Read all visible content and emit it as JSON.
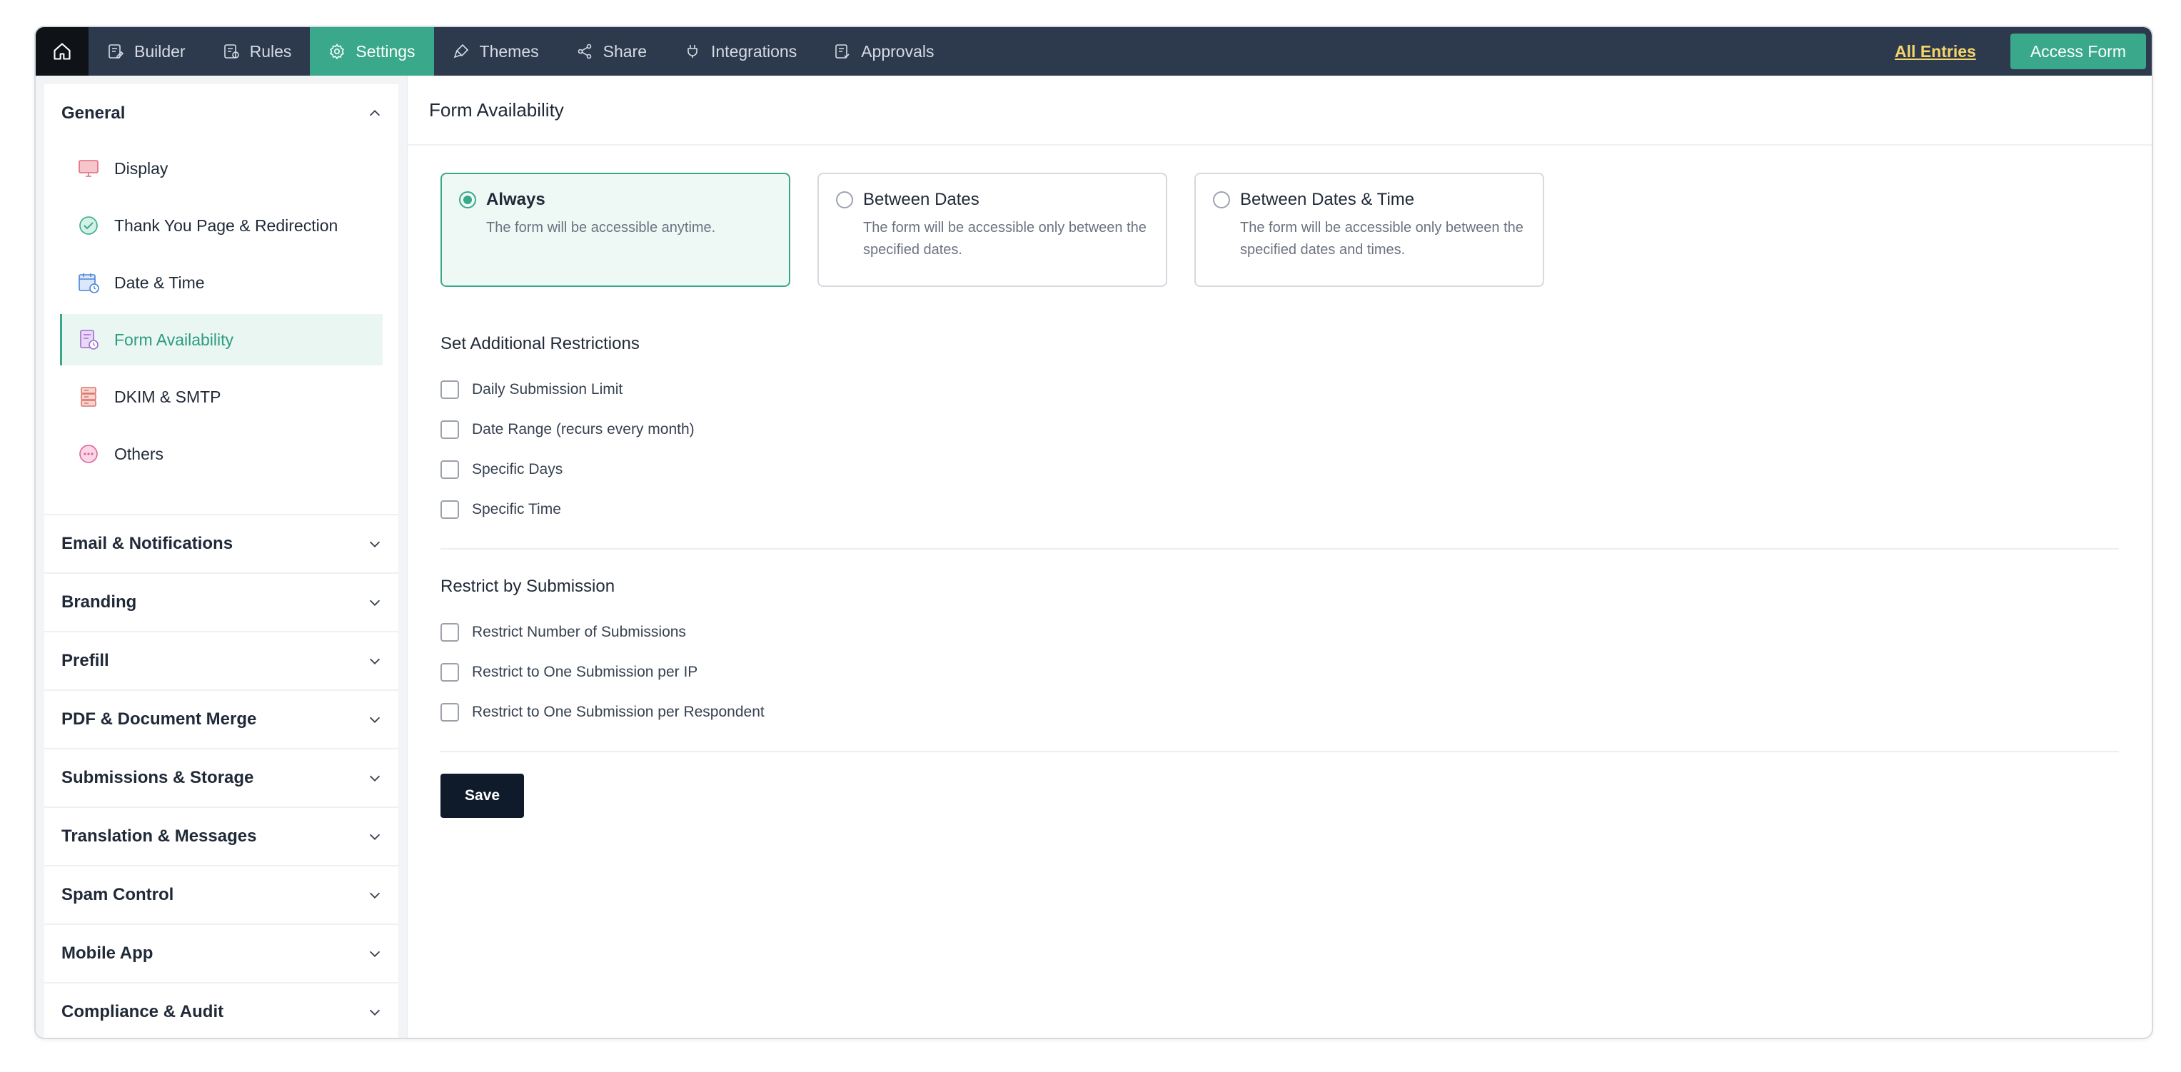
{
  "topbar": {
    "home_icon": "home-icon",
    "nav": [
      {
        "label": "Builder",
        "icon": "builder-icon",
        "active": false
      },
      {
        "label": "Rules",
        "icon": "rules-icon",
        "active": false
      },
      {
        "label": "Settings",
        "icon": "gear-icon",
        "active": true
      },
      {
        "label": "Themes",
        "icon": "brush-icon",
        "active": false
      },
      {
        "label": "Share",
        "icon": "share-icon",
        "active": false
      },
      {
        "label": "Integrations",
        "icon": "plug-icon",
        "active": false
      },
      {
        "label": "Approvals",
        "icon": "approvals-icon",
        "active": false
      }
    ],
    "all_entries_label": "All Entries",
    "access_form_label": "Access Form"
  },
  "sidebar": {
    "general": {
      "title": "General",
      "items": [
        {
          "label": "Display",
          "icon": "monitor-icon",
          "active": false
        },
        {
          "label": "Thank You Page & Redirection",
          "icon": "check-circle-icon",
          "active": false
        },
        {
          "label": "Date & Time",
          "icon": "calendar-clock-icon",
          "active": false
        },
        {
          "label": "Form Availability",
          "icon": "form-availability-icon",
          "active": true
        },
        {
          "label": "DKIM & SMTP",
          "icon": "server-icon",
          "active": false
        },
        {
          "label": "Others",
          "icon": "more-icon",
          "active": false
        }
      ]
    },
    "sections": [
      {
        "title": "Email & Notifications"
      },
      {
        "title": "Branding"
      },
      {
        "title": "Prefill"
      },
      {
        "title": "PDF & Document Merge"
      },
      {
        "title": "Submissions & Storage"
      },
      {
        "title": "Translation & Messages"
      },
      {
        "title": "Spam Control"
      },
      {
        "title": "Mobile App"
      },
      {
        "title": "Compliance & Audit"
      }
    ]
  },
  "main": {
    "title": "Form Availability",
    "availability_options": [
      {
        "title": "Always",
        "description": "The form will be accessible anytime.",
        "selected": true
      },
      {
        "title": "Between Dates",
        "description": "The form will be accessible only between the specified dates.",
        "selected": false
      },
      {
        "title": "Between Dates & Time",
        "description": "The form will be accessible only between the specified dates and times.",
        "selected": false
      }
    ],
    "additional_restrictions": {
      "title": "Set Additional Restrictions",
      "options": [
        {
          "label": "Daily Submission Limit",
          "checked": false
        },
        {
          "label": "Date Range (recurs every month)",
          "checked": false
        },
        {
          "label": "Specific Days",
          "checked": false
        },
        {
          "label": "Specific Time",
          "checked": false
        }
      ]
    },
    "restrict_by_submission": {
      "title": "Restrict by Submission",
      "options": [
        {
          "label": "Restrict Number of Submissions",
          "checked": false
        },
        {
          "label": "Restrict to One Submission per IP",
          "checked": false
        },
        {
          "label": "Restrict to One Submission per Respondent",
          "checked": false
        }
      ]
    },
    "save_label": "Save"
  },
  "colors": {
    "accent": "#3aa88a",
    "topbar_bg": "#2d3a4e",
    "home_bg": "#0f1318",
    "all_entries": "#f6d56b",
    "save_bg": "#0f1a2b"
  }
}
